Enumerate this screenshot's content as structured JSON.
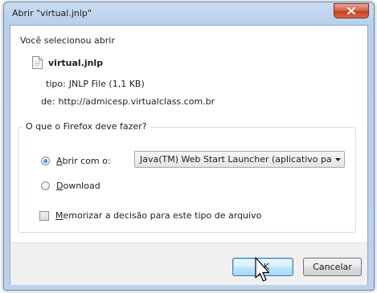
{
  "dialog": {
    "title": "Abrir \"virtual.jnlp\""
  },
  "intro_text": "Você selecionou abrir",
  "file": {
    "name": "virtual.jnlp",
    "type_label": "tipo:",
    "type_value": "JNLP File (1,1 KB)",
    "from_label": "de:",
    "from_value": "http://admicesp.virtualclass.com.br"
  },
  "action_group": {
    "legend": "O que o Firefox deve fazer?",
    "open_with_label": "Abrir com o:",
    "open_with_selected": true,
    "app_selected": "Java(TM) Web Start Launcher (aplicativo pa...",
    "download_label": "Download",
    "download_selected": false,
    "remember_label": "Memorizar a decisão para este tipo de arquivo",
    "remember_checked": false
  },
  "buttons": {
    "ok_label": "OK",
    "cancel_label": "Cancelar"
  },
  "colors": {
    "title_bar": "#bcd2ec",
    "close_button": "#c4401f",
    "default_button": "#bee6fd"
  },
  "icons": [
    "close-icon",
    "file-icon",
    "dropdown-arrow-icon",
    "mouse-pointer-icon"
  ]
}
